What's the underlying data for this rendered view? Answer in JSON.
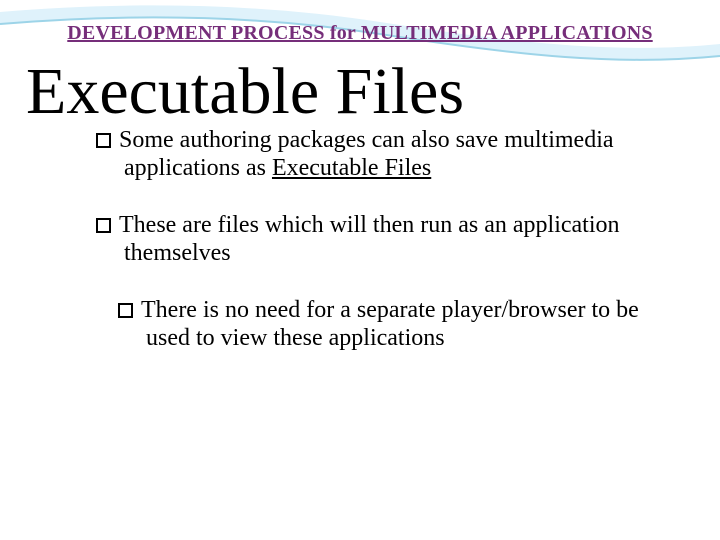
{
  "header": "DEVELOPMENT PROCESS for MULTIMEDIA APPLICATIONS",
  "title": "Executable Files",
  "bullets": [
    {
      "pre": "Some authoring packages can also save multimedia applications as ",
      "highlight": "Executable Files",
      "post": ""
    },
    {
      "pre": "These are files which will then run as an application themselves",
      "highlight": "",
      "post": ""
    },
    {
      "pre": "There is no need for a separate player/browser to be used to view these applications",
      "highlight": "",
      "post": ""
    }
  ]
}
